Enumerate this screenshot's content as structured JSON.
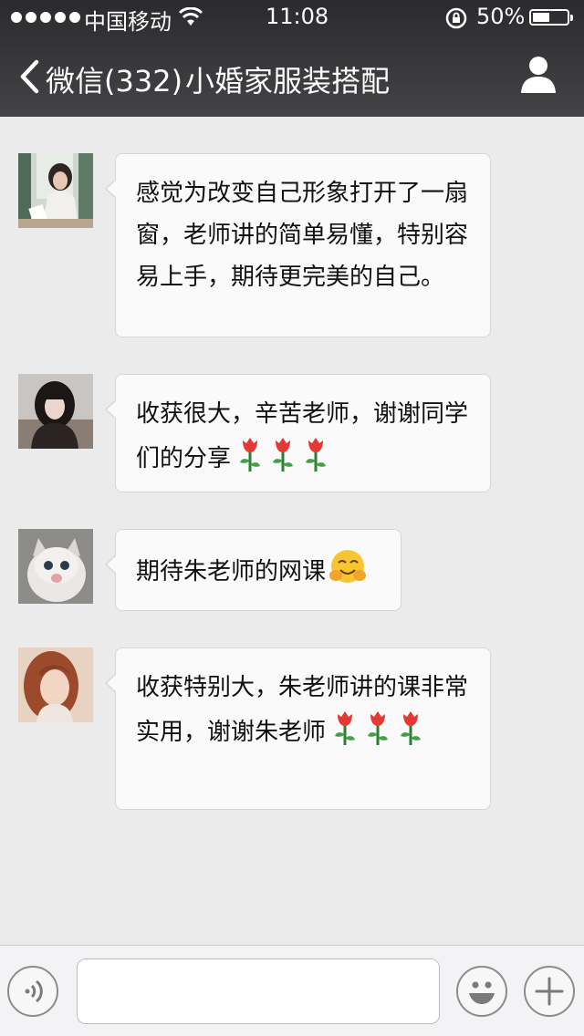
{
  "status_bar": {
    "carrier": "中国移动",
    "time": "11:08",
    "battery_percent": "50%",
    "battery_level": 0.5,
    "signal_bars": 5
  },
  "nav": {
    "back_label": "微信(332)",
    "title": "小婚家服装搭配"
  },
  "messages": [
    {
      "text": "感觉为改变自己形象打开了一扇窗，老师讲的简单易懂，特别容易上手，期待更完美的自己。",
      "emoji": []
    },
    {
      "text": "收获很大，辛苦老师，谢谢同学们的分享",
      "emoji": [
        "rose-icon",
        "rose-icon",
        "rose-icon"
      ]
    },
    {
      "text": "期待朱老师的网课",
      "emoji": [
        "hug-emoji-icon"
      ]
    },
    {
      "text": "收获特别大，朱老师讲的课非常实用，谢谢朱老师",
      "emoji": [
        "rose-icon",
        "rose-icon",
        "rose-icon"
      ]
    }
  ],
  "input": {
    "placeholder": ""
  },
  "colors": {
    "header_bg": "#3a3a3d",
    "chat_bg": "#ebebeb",
    "bubble_bg": "#fafafa"
  }
}
